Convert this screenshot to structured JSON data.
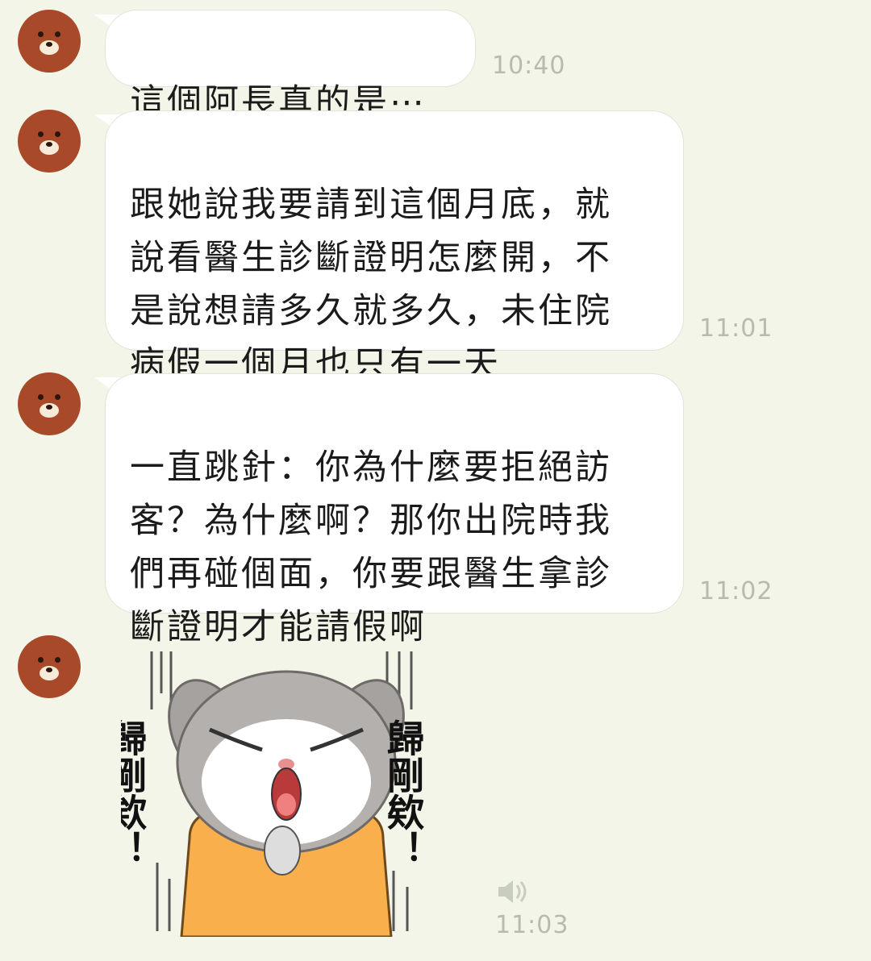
{
  "messages": [
    {
      "text": "這個阿長真的是⋯",
      "time": "10:40"
    },
    {
      "text": "跟她說我要請到這個月底，就\n說看醫生診斷證明怎麼開，不\n是說想請多久就多久，未住院\n病假一個月也只有一天",
      "time": "11:01"
    },
    {
      "text": "一直跳針：你為什麼要拒絕訪\n客？為什麼啊？那你出院時我\n們再碰個面，你要跟醫生拿診\n斷證明才能請假啊",
      "time": "11:02"
    },
    {
      "sticker": {
        "text_left": "歸剛欸！",
        "text_right": "歸剛欸！",
        "icon": "angry-bunny-sticker"
      },
      "audio_icon": "speaker-icon",
      "time": "11:03"
    }
  ],
  "colors": {
    "background": "#f3f5e9",
    "bubble": "#ffffff",
    "avatar": "#a84a2a",
    "timestamp": "#b7bbae"
  }
}
